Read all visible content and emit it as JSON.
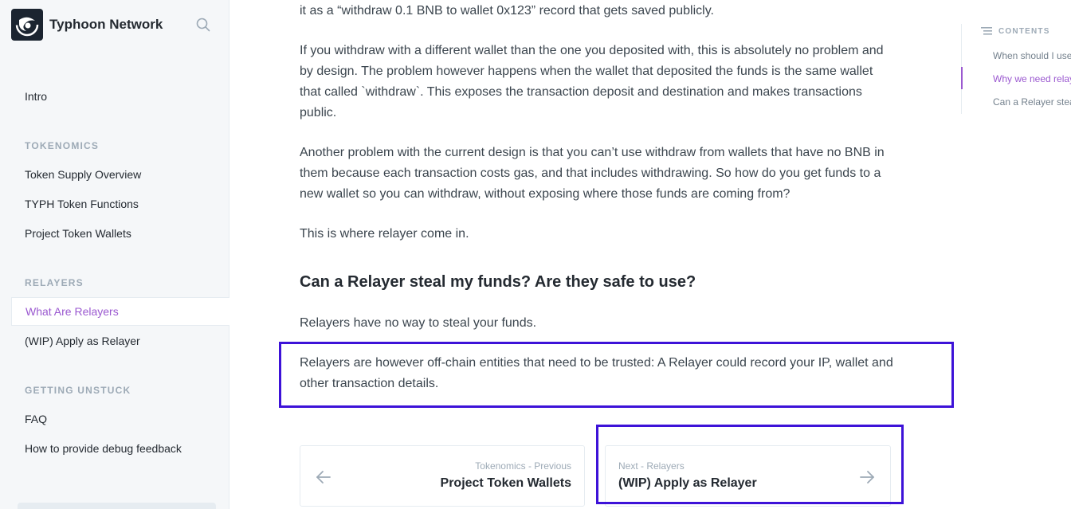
{
  "brand": {
    "name": "Typhoon Network"
  },
  "sidebar": {
    "intro": "Intro",
    "sections": [
      {
        "title": "TOKENOMICS",
        "items": [
          "Token Supply Overview",
          "TYPH Token Functions",
          "Project Token Wallets"
        ]
      },
      {
        "title": "RELAYERS",
        "items": [
          "What Are Relayers",
          "(WIP) Apply as Relayer"
        ]
      },
      {
        "title": "GETTING UNSTUCK",
        "items": [
          "FAQ",
          "How to provide debug feedback"
        ]
      }
    ],
    "active_item": "What Are Relayers"
  },
  "main": {
    "p0": "it as a “withdraw 0.1 BNB to wallet 0x123” record that gets saved publicly.",
    "p1": "If you withdraw with a different wallet than the one you deposited with, this is absolutely no problem and by design. The problem however happens when the wallet that deposited the funds is the same wallet that called `withdraw`. This exposes the transaction deposit and destination and makes transactions public.",
    "p2": "Another problem with the current design is that you can’t use withdraw from wallets that have no BNB in them because each transaction costs gas, and that includes withdrawing. So how do you get funds to a new wallet so you can withdraw, without exposing where those funds are coming from?",
    "p3": "This is where relayer come in.",
    "heading": "Can a Relayer steal my funds? Are they safe to use?",
    "p4": "Relayers have no way to steal your funds.",
    "p5": "Relayers are however off-chain entities that need to be trusted: A Relayer could record your IP, wallet and other transaction details."
  },
  "pagination": {
    "prev": {
      "kicker": "Tokenomics - Previous",
      "title": "Project Token Wallets"
    },
    "next": {
      "kicker": "Next - Relayers",
      "title": "(WIP) Apply as Relayer"
    }
  },
  "toc": {
    "header": "CONTENTS",
    "items": [
      "When should I use a relayer?",
      "Why we need relayers",
      "Can a Relayer steal my funds?"
    ],
    "active_index": 1
  },
  "colors": {
    "accent": "#9b59d0",
    "highlight_border": "#3d12d8"
  }
}
